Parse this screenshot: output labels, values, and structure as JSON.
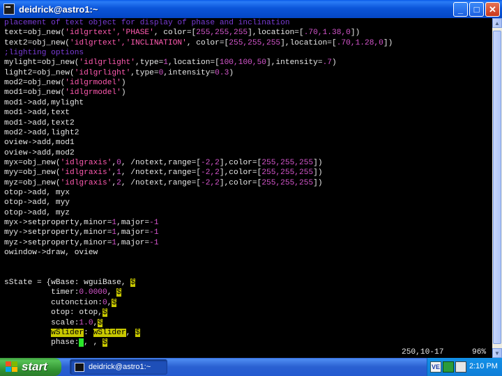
{
  "window": {
    "title": "deidrick@astro1:~",
    "buttons": {
      "minimize": "_",
      "maximize": "□",
      "close": "✕"
    }
  },
  "editor": {
    "lines": [
      [
        [
          "cmt",
          "placement of text object for display of phase and inclination"
        ]
      ],
      [
        [
          "idn",
          "text=obj_new("
        ],
        [
          "str",
          "'idlgrtext','PHASE'"
        ],
        [
          "idn",
          ", color=["
        ],
        [
          "num",
          "255,255,255"
        ],
        [
          "idn",
          "],location=["
        ],
        [
          "num",
          ".70,1.38,0"
        ],
        [
          "idn",
          "])"
        ]
      ],
      [
        [
          "idn",
          "text2=obj_new("
        ],
        [
          "str",
          "'idlgrtext','INCLINATION'"
        ],
        [
          "idn",
          ", color=["
        ],
        [
          "num",
          "255,255,255"
        ],
        [
          "idn",
          "],location=["
        ],
        [
          "num",
          ".70,1.28,0"
        ],
        [
          "idn",
          "])"
        ]
      ],
      [
        [
          "cmt",
          ";lighting options"
        ]
      ],
      [
        [
          "idn",
          "mylight=obj_new("
        ],
        [
          "str",
          "'idlgrlight'"
        ],
        [
          "idn",
          ",type="
        ],
        [
          "num",
          "1"
        ],
        [
          "idn",
          ",location=["
        ],
        [
          "num",
          "100,100,50"
        ],
        [
          "idn",
          "],intensity="
        ],
        [
          "num",
          ".7"
        ],
        [
          "idn",
          ")"
        ]
      ],
      [
        [
          "idn",
          "light2=obj_new("
        ],
        [
          "str",
          "'idlgrlight'"
        ],
        [
          "idn",
          ",type="
        ],
        [
          "num",
          "0"
        ],
        [
          "idn",
          ",intensity="
        ],
        [
          "num",
          "0.3"
        ],
        [
          "idn",
          ")"
        ]
      ],
      [
        [
          "idn",
          "mod2=obj_new("
        ],
        [
          "str",
          "'idlgrmodel'"
        ],
        [
          "idn",
          ")"
        ]
      ],
      [
        [
          "idn",
          "mod1=obj_new("
        ],
        [
          "str",
          "'idlgrmodel'"
        ],
        [
          "idn",
          ")"
        ]
      ],
      [
        [
          "idn",
          "mod1->add,mylight"
        ]
      ],
      [
        [
          "idn",
          "mod1->add,text"
        ]
      ],
      [
        [
          "idn",
          "mod1->add,text2"
        ]
      ],
      [
        [
          "idn",
          "mod2->add,light2"
        ]
      ],
      [
        [
          "idn",
          "oview->add,mod1"
        ]
      ],
      [
        [
          "idn",
          "oview->add,mod2"
        ]
      ],
      [
        [
          "idn",
          "myx=obj_new("
        ],
        [
          "str",
          "'idlgraxis'"
        ],
        [
          "idn",
          ","
        ],
        [
          "num",
          "0"
        ],
        [
          "idn",
          ", /notext,range=["
        ],
        [
          "num",
          "-2,2"
        ],
        [
          "idn",
          "],color=["
        ],
        [
          "num",
          "255,255,255"
        ],
        [
          "idn",
          "])"
        ]
      ],
      [
        [
          "idn",
          "myy=obj_new("
        ],
        [
          "str",
          "'idlgraxis'"
        ],
        [
          "idn",
          ","
        ],
        [
          "num",
          "1"
        ],
        [
          "idn",
          ", /notext,range=["
        ],
        [
          "num",
          "-2,2"
        ],
        [
          "idn",
          "],color=["
        ],
        [
          "num",
          "255,255,255"
        ],
        [
          "idn",
          "])"
        ]
      ],
      [
        [
          "idn",
          "myz=obj_new("
        ],
        [
          "str",
          "'idlgraxis'"
        ],
        [
          "idn",
          ","
        ],
        [
          "num",
          "2"
        ],
        [
          "idn",
          ", /notext,range=["
        ],
        [
          "num",
          "-2,2"
        ],
        [
          "idn",
          "],color=["
        ],
        [
          "num",
          "255,255,255"
        ],
        [
          "idn",
          "])"
        ]
      ],
      [
        [
          "idn",
          "otop->add, myx"
        ]
      ],
      [
        [
          "idn",
          "otop->add, myy"
        ]
      ],
      [
        [
          "idn",
          "otop->add, myz"
        ]
      ],
      [
        [
          "idn",
          "myx->setproperty,minor="
        ],
        [
          "num",
          "1"
        ],
        [
          "idn",
          ",major="
        ],
        [
          "num",
          "-1"
        ]
      ],
      [
        [
          "idn",
          "myy->setproperty,minor="
        ],
        [
          "num",
          "1"
        ],
        [
          "idn",
          ",major="
        ],
        [
          "num",
          "-1"
        ]
      ],
      [
        [
          "idn",
          "myz->setproperty,minor="
        ],
        [
          "num",
          "1"
        ],
        [
          "idn",
          ",major="
        ],
        [
          "num",
          "-1"
        ]
      ],
      [
        [
          "idn",
          "owindow->draw, oview"
        ]
      ],
      [
        [
          "idn",
          ""
        ]
      ],
      [
        [
          "idn",
          ""
        ]
      ],
      [
        [
          "idn",
          "sState = {wBase: wguiBase, "
        ],
        [
          "hl",
          "$"
        ]
      ],
      [
        [
          "idn",
          "          timer:"
        ],
        [
          "num",
          "0.0000"
        ],
        [
          "idn",
          ", "
        ],
        [
          "hl",
          "$"
        ]
      ],
      [
        [
          "idn",
          "          cutonction:"
        ],
        [
          "num",
          "0"
        ],
        [
          "idn",
          ","
        ],
        [
          "hl",
          "$"
        ]
      ],
      [
        [
          "idn",
          "          otop: otop,"
        ],
        [
          "hl",
          "$"
        ]
      ],
      [
        [
          "idn",
          "          scale:"
        ],
        [
          "num",
          "1.0"
        ],
        [
          "idn",
          ","
        ],
        [
          "hl",
          "$"
        ]
      ],
      [
        [
          "idn",
          "          "
        ],
        [
          "hl",
          "wSlider"
        ],
        [
          "idn",
          ": "
        ],
        [
          "hl",
          "wSlider"
        ],
        [
          "idn",
          ", "
        ],
        [
          "hl",
          "$"
        ]
      ],
      [
        [
          "idn",
          "          phase:"
        ],
        [
          "cursor",
          " "
        ],
        [
          "idn",
          ", , "
        ],
        [
          "hl",
          "$"
        ]
      ]
    ],
    "status_position": "250,10-17",
    "status_percent": "96%"
  },
  "taskbar": {
    "start_label": "start",
    "task_label": "deidrick@astro1:~",
    "tray_icons": [
      "ve-icon",
      "network-icon",
      "antivirus-icon"
    ],
    "clock": "2:10 PM"
  }
}
